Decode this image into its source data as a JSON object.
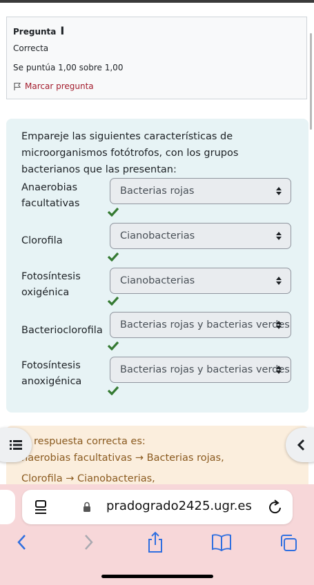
{
  "info": {
    "question_label": "Pregunta",
    "question_number": "I",
    "state": "Correcta",
    "grade": "Se puntúa 1,00 sobre 1,00",
    "flag_label": "Marcar pregunta"
  },
  "question": {
    "text": "Empareje las siguientes características de microorganismos fotótrofos, con los grupos bacterianos que las presentan:",
    "rows": [
      {
        "label": "Anaerobias facultativas",
        "answer": "Bacterias rojas"
      },
      {
        "label": "Clorofila",
        "answer": "Cianobacterias"
      },
      {
        "label": "Fotosíntesis oxigénica",
        "answer": "Cianobacterias"
      },
      {
        "label": "Bacterioclorofila",
        "answer": "Bacterias rojas y bacterias verdes"
      },
      {
        "label": "Fotosíntesis anoxigénica",
        "answer": "Bacterias rojas y bacterias verdes"
      }
    ]
  },
  "feedback": {
    "line1": "respuesta correcta es:",
    "line2": "naerobias facultativas → Bacterias rojas,",
    "line3": "Clorofila → Cianobacterias,"
  },
  "browser": {
    "domain": "pradogrado2425.ugr.es"
  },
  "colors": {
    "check": "#357a32",
    "flag": "#a31b2c",
    "formulation_bg": "#e7f3f5",
    "feedback_bg": "#fbeedd",
    "browser_bg": "#f7d7d9",
    "toolbar_icons": "#2f6fe0"
  },
  "icons": [
    "flag-icon",
    "check-icon",
    "sort-arrows-icon",
    "list-icon",
    "chevron-left-icon",
    "reader-icon",
    "lock-icon",
    "reload-icon",
    "back-icon",
    "forward-icon",
    "share-icon",
    "bookmarks-icon",
    "tabs-icon"
  ]
}
